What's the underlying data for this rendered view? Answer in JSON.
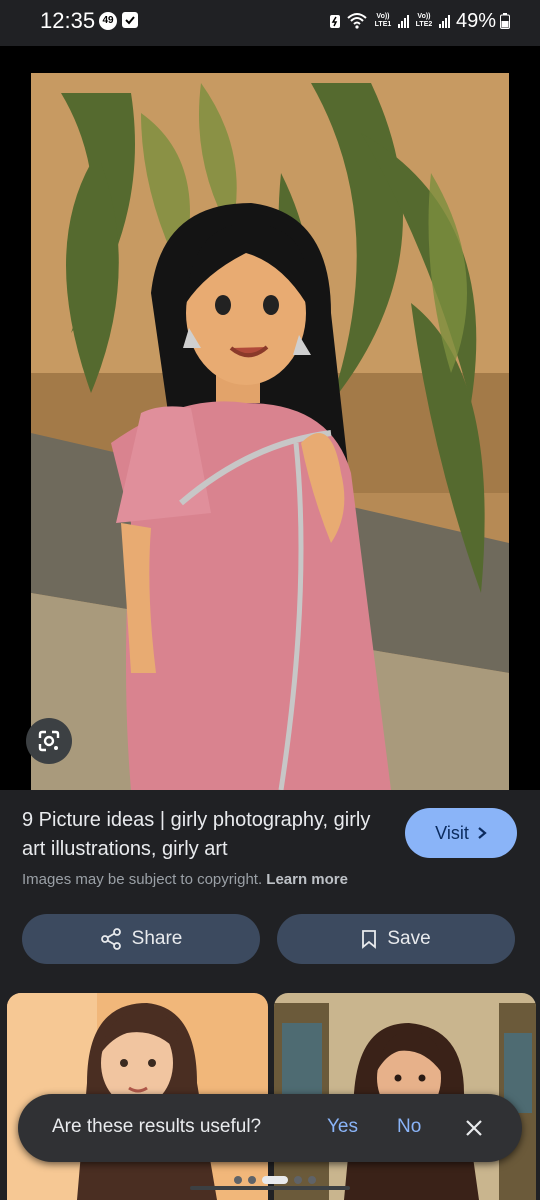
{
  "status_bar": {
    "time": "12:35",
    "notification_badge": "49",
    "lte1_label": "Vo)) LTE1",
    "lte2_label": "Vo)) LTE2",
    "battery": "49%"
  },
  "image": {
    "icon": "google-lens-icon"
  },
  "result": {
    "title": "9 Picture ideas | girly photography, girly art illustrations, girly art",
    "visit_label": "Visit",
    "copyright_text": "Images may be subject to copyright.",
    "learn_more_label": "Learn more"
  },
  "actions": {
    "share_label": "Share",
    "save_label": "Save"
  },
  "feedback": {
    "question": "Are these results useful?",
    "yes_label": "Yes",
    "no_label": "No"
  },
  "colors": {
    "background": "#202124",
    "accent_blue": "#8ab4f8",
    "action_button": "#3c4a5f",
    "snackbar": "#303134"
  }
}
